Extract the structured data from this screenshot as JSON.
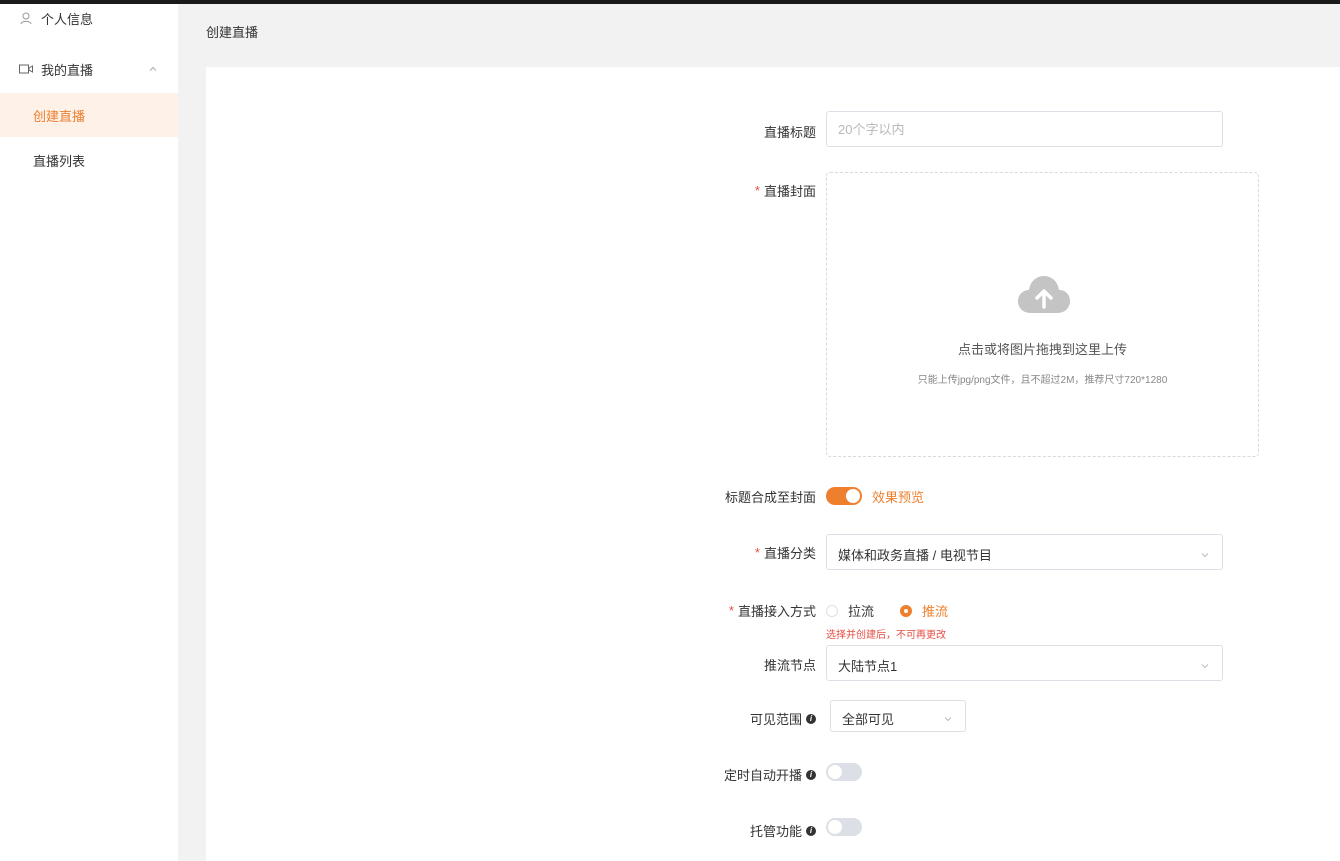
{
  "sidebar": {
    "items": [
      {
        "label": "个人信息",
        "icon": "user-icon"
      },
      {
        "label": "我的直播",
        "icon": "video-camera-icon"
      },
      {
        "label": "创建直播",
        "active": true
      },
      {
        "label": "直播列表"
      }
    ]
  },
  "page": {
    "title": "创建直播"
  },
  "form": {
    "title": {
      "label": "直播标题",
      "placeholder": "20个字以内",
      "value": ""
    },
    "cover": {
      "label": "直播封面",
      "upload_text": "点击或将图片拖拽到这里上传",
      "upload_hint": "只能上传jpg/png文件，且不超过2M，推荐尺寸720*1280"
    },
    "title_merge": {
      "label": "标题合成至封面",
      "enabled": true,
      "preview_link": "效果预览"
    },
    "category": {
      "label": "直播分类",
      "value": "媒体和政务直播 / 电视节目"
    },
    "access_mode": {
      "label": "直播接入方式",
      "options": [
        "拉流",
        "推流"
      ],
      "selected": "推流",
      "hint": "选择并创建后，不可再更改"
    },
    "push_node": {
      "label": "推流节点",
      "value": "大陆节点1"
    },
    "visibility": {
      "label": "可见范围",
      "value": "全部可见"
    },
    "scheduled_start": {
      "label": "定时自动开播",
      "enabled": false
    },
    "hosting": {
      "label": "托管功能",
      "enabled": false
    }
  },
  "colors": {
    "accent": "#ee7f2d",
    "required": "#e54d42",
    "background": "#f2f2f2"
  }
}
